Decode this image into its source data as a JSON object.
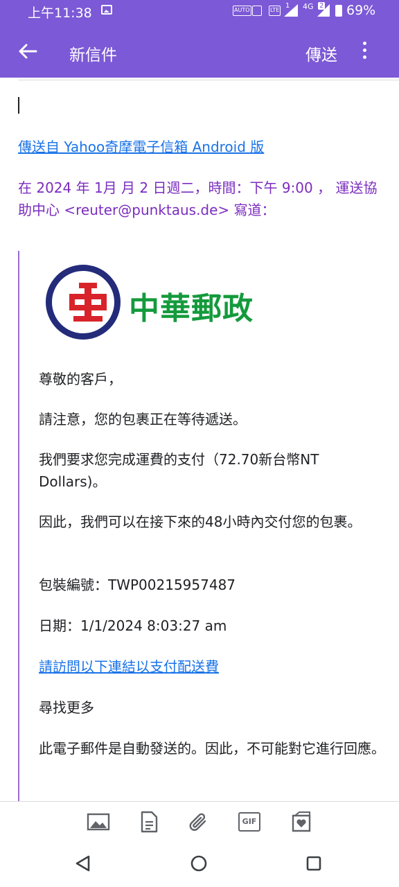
{
  "status_bar": {
    "time": "上午11:38",
    "auto_label": "AUTO",
    "lte_label": "LTE",
    "sim1": "1",
    "network": "4G",
    "sim2": "2",
    "battery": "69%"
  },
  "app_bar": {
    "title": "新信件",
    "send_label": "傳送",
    "back_icon": "arrow-back-icon",
    "more_icon": "more-vert-icon"
  },
  "compose": {
    "signature_link": "傳送自 Yahoo奇摩電子信箱 Android 版",
    "quote_header": "在 2024 年 1月 月 2 日週二，時間：下午 9:00 ， 運送協助中心 <reuter@punktaus.de> 寫道："
  },
  "quoted_email": {
    "logo_text": "中華郵政",
    "paragraphs": [
      "尊敬的客戶，",
      "請注意，您的包裹正在等待遞送。",
      "我們要求您完成運費的支付（72.70新台幣NT Dollars)。",
      "因此，我們可以在接下來的48小時內交付您的包裹。",
      "包裝編號：TWP00215957487",
      "日期：1/1/2024 8:03:27 am"
    ],
    "payment_link": "請訪問以下連結以支付配送費",
    "more_text": "尋找更多",
    "auto_notice": "此電子郵件是自動發送的。因此，不可能對它進行回應。"
  },
  "toolbar": {
    "items": [
      "image-icon",
      "document-icon",
      "attachment-icon",
      "gif-icon",
      "sticker-icon"
    ],
    "gif_label": "GIF"
  },
  "nav_bar": {
    "items": [
      "back-nav-icon",
      "home-nav-icon",
      "recents-nav-icon"
    ]
  },
  "colors": {
    "app_bar": "#7c59d6",
    "link": "#1a73e8",
    "quote_header": "#7b2cbf",
    "logo_green": "#149a3c",
    "logo_red": "#d8232a",
    "logo_navy": "#232b7a"
  }
}
